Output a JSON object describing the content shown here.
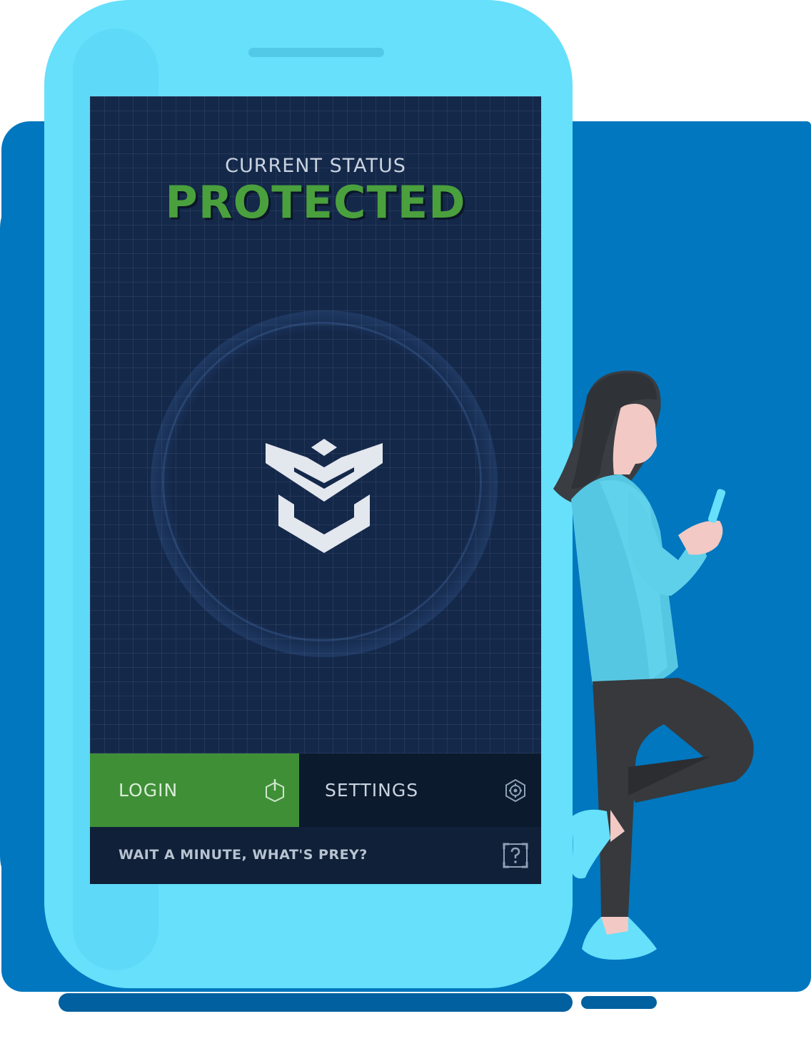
{
  "colors": {
    "background": "#0077bf",
    "phone_body": "#66e0fb",
    "screen": "#14284a",
    "accent_green": "#4aa03d",
    "login_button": "#3f8f37"
  },
  "status": {
    "caption": "CURRENT STATUS",
    "value": "PROTECTED"
  },
  "center_icon": "prey-shield-logo",
  "actions": {
    "login": {
      "label": "LOGIN",
      "icon": "power-icon"
    },
    "settings": {
      "label": "SETTINGS",
      "icon": "gear-icon"
    }
  },
  "help": {
    "label": "WAIT A MINUTE, WHAT'S PREY?",
    "icon": "help-icon"
  }
}
